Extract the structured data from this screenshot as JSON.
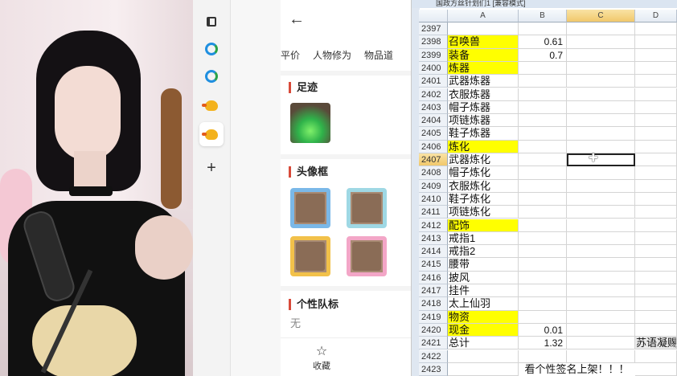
{
  "panel": {
    "tabs": [
      "平价",
      "人物修为",
      "物品道"
    ],
    "sections": {
      "footprint": "足迹",
      "avatar_frame": "头像框",
      "team_badge": "个性队标",
      "team_badge_value": "无"
    },
    "bottom": {
      "favorite_label": "收藏"
    }
  },
  "excel": {
    "title": "国政方丝针划们1 [兼容模式]",
    "columns": [
      "A",
      "B",
      "C",
      "D"
    ],
    "selected_column": "C",
    "selected_row": "2407",
    "rows": [
      {
        "n": "2397",
        "a": "",
        "b": "",
        "hl": false
      },
      {
        "n": "2398",
        "a": "召唤兽",
        "b": "0.61",
        "hl": true
      },
      {
        "n": "2399",
        "a": "装备",
        "b": "0.7",
        "hl": true
      },
      {
        "n": "2400",
        "a": "炼器",
        "b": "",
        "hl": true
      },
      {
        "n": "2401",
        "a": "武器炼器",
        "b": "",
        "hl": false
      },
      {
        "n": "2402",
        "a": "衣服炼器",
        "b": "",
        "hl": false
      },
      {
        "n": "2403",
        "a": "帽子炼器",
        "b": "",
        "hl": false
      },
      {
        "n": "2404",
        "a": "项链炼器",
        "b": "",
        "hl": false
      },
      {
        "n": "2405",
        "a": "鞋子炼器",
        "b": "",
        "hl": false
      },
      {
        "n": "2406",
        "a": "炼化",
        "b": "",
        "hl": true
      },
      {
        "n": "2407",
        "a": "武器炼化",
        "b": "",
        "hl": false
      },
      {
        "n": "2408",
        "a": "帽子炼化",
        "b": "",
        "hl": false
      },
      {
        "n": "2409",
        "a": "衣服炼化",
        "b": "",
        "hl": false
      },
      {
        "n": "2410",
        "a": "鞋子炼化",
        "b": "",
        "hl": false
      },
      {
        "n": "2411",
        "a": "项链炼化",
        "b": "",
        "hl": false
      },
      {
        "n": "2412",
        "a": "配饰",
        "b": "",
        "hl": true
      },
      {
        "n": "2413",
        "a": "戒指1",
        "b": "",
        "hl": false
      },
      {
        "n": "2414",
        "a": "戒指2",
        "b": "",
        "hl": false
      },
      {
        "n": "2415",
        "a": "腰带",
        "b": "",
        "hl": false
      },
      {
        "n": "2416",
        "a": "披风",
        "b": "",
        "hl": false
      },
      {
        "n": "2417",
        "a": "挂件",
        "b": "",
        "hl": false
      },
      {
        "n": "2418",
        "a": "太上仙羽",
        "b": "",
        "hl": false
      },
      {
        "n": "2419",
        "a": "物资",
        "b": "",
        "hl": true
      },
      {
        "n": "2420",
        "a": "现金",
        "b": "0.01",
        "hl": true
      },
      {
        "n": "2421",
        "a": "总计",
        "b": "1.32",
        "hl": false
      },
      {
        "n": "2422",
        "a": "",
        "b": "",
        "hl": false
      },
      {
        "n": "2423",
        "a": "",
        "b": "",
        "hl": false
      }
    ],
    "d2421": "苏语凝赐",
    "banner": "看个性签名上架！！！"
  }
}
